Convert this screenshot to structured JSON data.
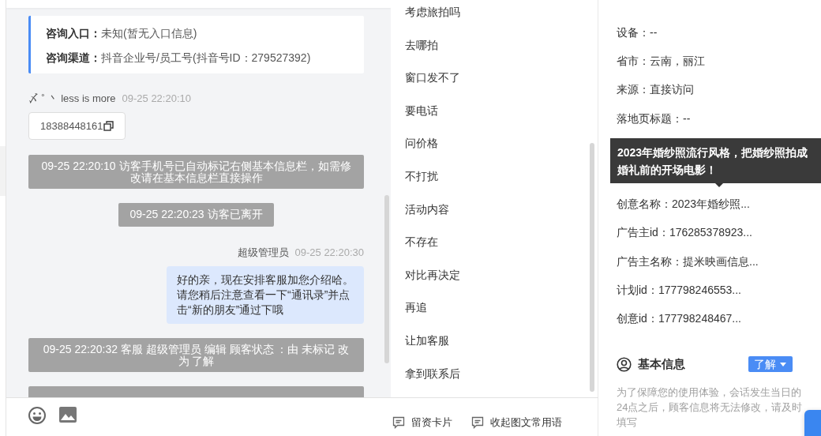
{
  "chat": {
    "entry_card": [
      {
        "label": "咨询入口：",
        "value": "未知(暂无入口信息)"
      },
      {
        "label": "咨询渠道：",
        "value": "抖音企业号/员工号(抖音号ID：279527392)"
      }
    ],
    "messages": [
      {
        "kind": "visitor",
        "name": "〆 ˚ 丶 less is more",
        "time": "09-25 22:20:10"
      },
      {
        "kind": "phone",
        "text": "18388448161"
      },
      {
        "kind": "system",
        "text": "09-25 22:20:10 访客手机号已自动标记右侧基本信息栏，如需修改请在基本信息栏直接操作"
      },
      {
        "kind": "notice",
        "text": "09-25 22:20:23 访客已离开"
      },
      {
        "kind": "agent",
        "name": "超级管理员",
        "time": "09-25 22:20:30"
      },
      {
        "kind": "bubble",
        "text": "好的亲，现在安排客服加您介绍哈。请您稍后注意查看一下“通讯录”并点击“新的朋友”通过下哦"
      },
      {
        "kind": "system",
        "text": "09-25 22:20:32 客服 超级管理员 编辑 顾客状态 ：由 未标记 改为 了解"
      },
      {
        "kind": "cut_off"
      }
    ]
  },
  "phrases": [
    "考虑旅拍吗",
    "去哪拍",
    "窗口发不了",
    "要电话",
    "问价格",
    "不打扰",
    "活动内容",
    "不存在",
    "对比再决定",
    "再追",
    "让加客服",
    "拿到联系后"
  ],
  "toolbar": {
    "buttons": [
      "留资卡片",
      "收起图文常用语"
    ]
  },
  "info": {
    "rows": [
      {
        "kind": "text",
        "text": "设备：--"
      },
      {
        "kind": "text",
        "text": "省市：云南，丽江"
      },
      {
        "kind": "text",
        "text": "来源：直接访问"
      },
      {
        "kind": "text",
        "text": "落地页标题：--"
      },
      {
        "kind": "covered"
      },
      {
        "kind": "covered"
      },
      {
        "kind": "text",
        "text": "创意名称：2023年婚纱照..."
      },
      {
        "kind": "text",
        "text": "广告主id：176285378923..."
      },
      {
        "kind": "text",
        "text": "广告主名称：提米映画信息..."
      },
      {
        "kind": "text",
        "text": "计划id：177798246553..."
      },
      {
        "kind": "text",
        "text": "创意id：177798248467..."
      }
    ],
    "tooltip": "2023年婚纱照流行风格，把婚纱照拍成婚礼前的开场电影！",
    "section_title": "基本信息",
    "status_button": "了解",
    "note": "为了保障您的使用体验，会话发生当日的24点之后，顾客信息将无法修改，请及时填写"
  }
}
